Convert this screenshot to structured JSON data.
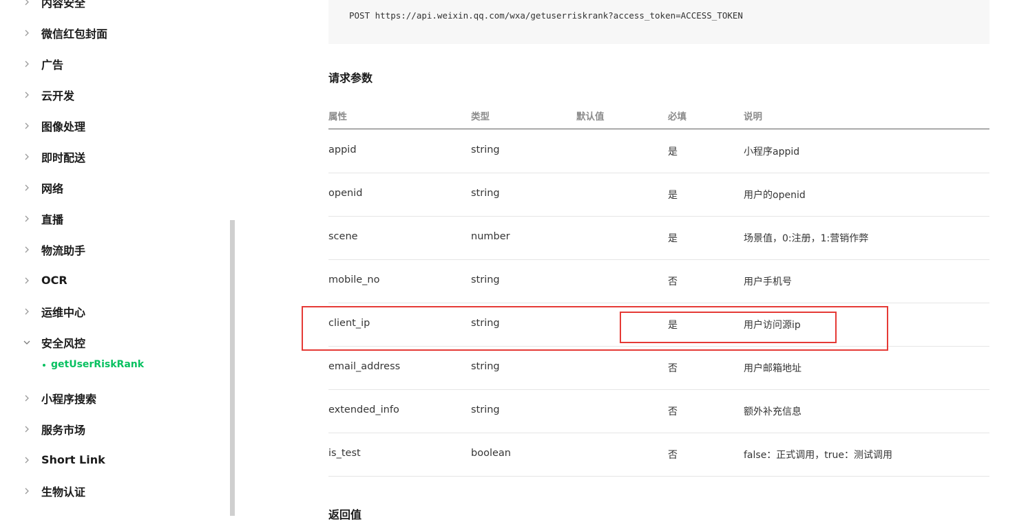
{
  "sidebar": {
    "items": [
      {
        "label": "内容安全",
        "expanded": false
      },
      {
        "label": "微信红包封面",
        "expanded": false
      },
      {
        "label": "广告",
        "expanded": false
      },
      {
        "label": "云开发",
        "expanded": false
      },
      {
        "label": "图像处理",
        "expanded": false
      },
      {
        "label": "即时配送",
        "expanded": false
      },
      {
        "label": "网络",
        "expanded": false
      },
      {
        "label": "直播",
        "expanded": false
      },
      {
        "label": "物流助手",
        "expanded": false
      },
      {
        "label": "OCR",
        "expanded": false
      },
      {
        "label": "运维中心",
        "expanded": false
      },
      {
        "label": "安全风控",
        "expanded": true
      },
      {
        "label": "小程序搜索",
        "expanded": false
      },
      {
        "label": "服务市场",
        "expanded": false
      },
      {
        "label": "Short Link",
        "expanded": false
      },
      {
        "label": "生物认证",
        "expanded": false
      }
    ],
    "active_sub_item": "getUserRiskRank"
  },
  "main": {
    "request_code": "POST https://api.weixin.qq.com/wxa/getuserriskrank?access_token=ACCESS_TOKEN",
    "params_title": "请求参数",
    "return_title": "返回值",
    "table": {
      "headers": {
        "name": "属性",
        "type": "类型",
        "default": "默认值",
        "required": "必填",
        "desc": "说明"
      },
      "rows": [
        {
          "name": "appid",
          "type": "string",
          "default": "",
          "required": "是",
          "desc": "小程序appid"
        },
        {
          "name": "openid",
          "type": "string",
          "default": "",
          "required": "是",
          "desc": "用户的openid"
        },
        {
          "name": "scene",
          "type": "number",
          "default": "",
          "required": "是",
          "desc": "场景值，0:注册，1:营销作弊"
        },
        {
          "name": "mobile_no",
          "type": "string",
          "default": "",
          "required": "否",
          "desc": "用户手机号"
        },
        {
          "name": "client_ip",
          "type": "string",
          "default": "",
          "required": "是",
          "desc": "用户访问源ip"
        },
        {
          "name": "email_address",
          "type": "string",
          "default": "",
          "required": "否",
          "desc": "用户邮箱地址"
        },
        {
          "name": "extended_info",
          "type": "string",
          "default": "",
          "required": "否",
          "desc": "额外补充信息"
        },
        {
          "name": "is_test",
          "type": "boolean",
          "default": "",
          "required": "否",
          "desc": "false：正式调用，true：测试调用"
        }
      ]
    }
  },
  "colors": {
    "accent": "#07c160",
    "highlight": "#e53935",
    "code_bg": "#f7f7f7"
  },
  "icons": {
    "collapsed": "chevron-right-icon",
    "expanded": "chevron-down-icon"
  }
}
